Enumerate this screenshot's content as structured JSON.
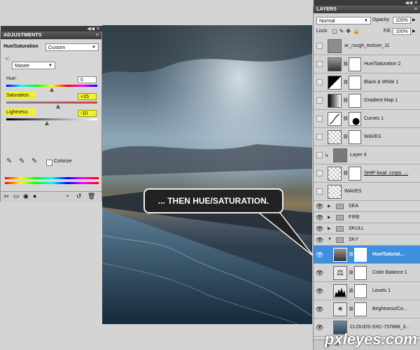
{
  "adjustments": {
    "title": "ADJUSTMENTS",
    "mode_label": "Hue/Saturation",
    "preset": "Custom",
    "channel": "Master",
    "hue_label": "Hue:",
    "hue_value": "0",
    "saturation_label": "Saturation:",
    "saturation_value": "+15",
    "lightness_label": "Lightness:",
    "lightness_value": "-10",
    "colorize_label": "Colorize"
  },
  "layers": {
    "title": "LAYERS",
    "blend_mode": "Normal",
    "opacity_label": "Opacity:",
    "opacity_value": "100%",
    "lock_label": "Lock:",
    "fill_label": "Fill:",
    "fill_value": "100%",
    "items": [
      {
        "name": "ar_rough_texture_11"
      },
      {
        "name": "Hue/Saturation 2"
      },
      {
        "name": "Black & White 1"
      },
      {
        "name": "Gradient Map 1"
      },
      {
        "name": "Curves 1"
      },
      {
        "name": "WAVES"
      },
      {
        "name": "Layer 4"
      },
      {
        "name": "SHIP-boat_crops_..."
      },
      {
        "name": "WAVES"
      },
      {
        "name": "SEA"
      },
      {
        "name": "FIRE"
      },
      {
        "name": "SKULL"
      },
      {
        "name": "SKY"
      },
      {
        "name": "Hue/Saturat..."
      },
      {
        "name": "Color Balance 1"
      },
      {
        "name": "Levels 1"
      },
      {
        "name": "Brightness/Co..."
      },
      {
        "name": "CLOUDS-SXC-737888_3..."
      }
    ]
  },
  "callout": "... THEN HUE/SATURATION.",
  "watermark": "pxleyes.com",
  "colors": {
    "selection": "#3d8fe0",
    "highlight": "#f2ef2b",
    "panel": "#d4d4d4"
  }
}
